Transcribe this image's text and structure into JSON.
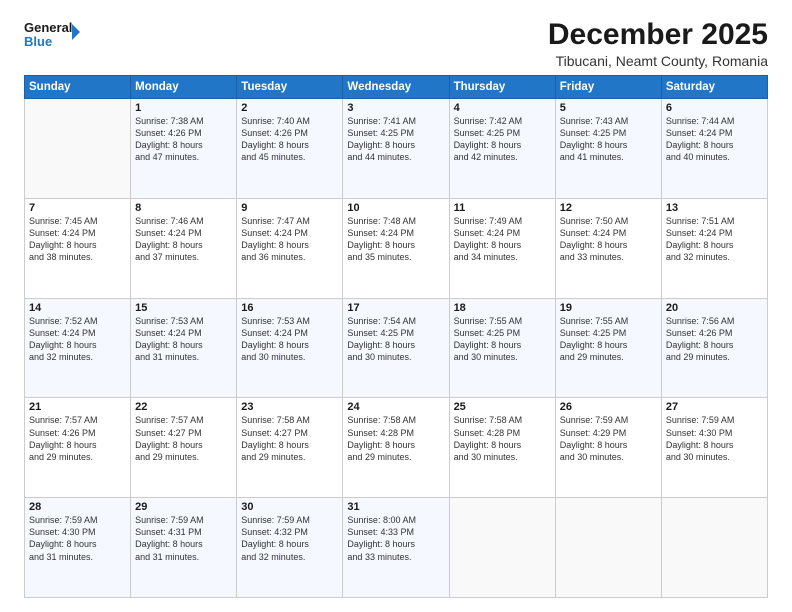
{
  "header": {
    "logo_line1": "General",
    "logo_line2": "Blue",
    "month": "December 2025",
    "location": "Tibucani, Neamt County, Romania"
  },
  "weekdays": [
    "Sunday",
    "Monday",
    "Tuesday",
    "Wednesday",
    "Thursday",
    "Friday",
    "Saturday"
  ],
  "weeks": [
    [
      {
        "day": "",
        "info": ""
      },
      {
        "day": "1",
        "info": "Sunrise: 7:38 AM\nSunset: 4:26 PM\nDaylight: 8 hours\nand 47 minutes."
      },
      {
        "day": "2",
        "info": "Sunrise: 7:40 AM\nSunset: 4:26 PM\nDaylight: 8 hours\nand 45 minutes."
      },
      {
        "day": "3",
        "info": "Sunrise: 7:41 AM\nSunset: 4:25 PM\nDaylight: 8 hours\nand 44 minutes."
      },
      {
        "day": "4",
        "info": "Sunrise: 7:42 AM\nSunset: 4:25 PM\nDaylight: 8 hours\nand 42 minutes."
      },
      {
        "day": "5",
        "info": "Sunrise: 7:43 AM\nSunset: 4:25 PM\nDaylight: 8 hours\nand 41 minutes."
      },
      {
        "day": "6",
        "info": "Sunrise: 7:44 AM\nSunset: 4:24 PM\nDaylight: 8 hours\nand 40 minutes."
      }
    ],
    [
      {
        "day": "7",
        "info": "Sunrise: 7:45 AM\nSunset: 4:24 PM\nDaylight: 8 hours\nand 38 minutes."
      },
      {
        "day": "8",
        "info": "Sunrise: 7:46 AM\nSunset: 4:24 PM\nDaylight: 8 hours\nand 37 minutes."
      },
      {
        "day": "9",
        "info": "Sunrise: 7:47 AM\nSunset: 4:24 PM\nDaylight: 8 hours\nand 36 minutes."
      },
      {
        "day": "10",
        "info": "Sunrise: 7:48 AM\nSunset: 4:24 PM\nDaylight: 8 hours\nand 35 minutes."
      },
      {
        "day": "11",
        "info": "Sunrise: 7:49 AM\nSunset: 4:24 PM\nDaylight: 8 hours\nand 34 minutes."
      },
      {
        "day": "12",
        "info": "Sunrise: 7:50 AM\nSunset: 4:24 PM\nDaylight: 8 hours\nand 33 minutes."
      },
      {
        "day": "13",
        "info": "Sunrise: 7:51 AM\nSunset: 4:24 PM\nDaylight: 8 hours\nand 32 minutes."
      }
    ],
    [
      {
        "day": "14",
        "info": "Sunrise: 7:52 AM\nSunset: 4:24 PM\nDaylight: 8 hours\nand 32 minutes."
      },
      {
        "day": "15",
        "info": "Sunrise: 7:53 AM\nSunset: 4:24 PM\nDaylight: 8 hours\nand 31 minutes."
      },
      {
        "day": "16",
        "info": "Sunrise: 7:53 AM\nSunset: 4:24 PM\nDaylight: 8 hours\nand 30 minutes."
      },
      {
        "day": "17",
        "info": "Sunrise: 7:54 AM\nSunset: 4:25 PM\nDaylight: 8 hours\nand 30 minutes."
      },
      {
        "day": "18",
        "info": "Sunrise: 7:55 AM\nSunset: 4:25 PM\nDaylight: 8 hours\nand 30 minutes."
      },
      {
        "day": "19",
        "info": "Sunrise: 7:55 AM\nSunset: 4:25 PM\nDaylight: 8 hours\nand 29 minutes."
      },
      {
        "day": "20",
        "info": "Sunrise: 7:56 AM\nSunset: 4:26 PM\nDaylight: 8 hours\nand 29 minutes."
      }
    ],
    [
      {
        "day": "21",
        "info": "Sunrise: 7:57 AM\nSunset: 4:26 PM\nDaylight: 8 hours\nand 29 minutes."
      },
      {
        "day": "22",
        "info": "Sunrise: 7:57 AM\nSunset: 4:27 PM\nDaylight: 8 hours\nand 29 minutes."
      },
      {
        "day": "23",
        "info": "Sunrise: 7:58 AM\nSunset: 4:27 PM\nDaylight: 8 hours\nand 29 minutes."
      },
      {
        "day": "24",
        "info": "Sunrise: 7:58 AM\nSunset: 4:28 PM\nDaylight: 8 hours\nand 29 minutes."
      },
      {
        "day": "25",
        "info": "Sunrise: 7:58 AM\nSunset: 4:28 PM\nDaylight: 8 hours\nand 30 minutes."
      },
      {
        "day": "26",
        "info": "Sunrise: 7:59 AM\nSunset: 4:29 PM\nDaylight: 8 hours\nand 30 minutes."
      },
      {
        "day": "27",
        "info": "Sunrise: 7:59 AM\nSunset: 4:30 PM\nDaylight: 8 hours\nand 30 minutes."
      }
    ],
    [
      {
        "day": "28",
        "info": "Sunrise: 7:59 AM\nSunset: 4:30 PM\nDaylight: 8 hours\nand 31 minutes."
      },
      {
        "day": "29",
        "info": "Sunrise: 7:59 AM\nSunset: 4:31 PM\nDaylight: 8 hours\nand 31 minutes."
      },
      {
        "day": "30",
        "info": "Sunrise: 7:59 AM\nSunset: 4:32 PM\nDaylight: 8 hours\nand 32 minutes."
      },
      {
        "day": "31",
        "info": "Sunrise: 8:00 AM\nSunset: 4:33 PM\nDaylight: 8 hours\nand 33 minutes."
      },
      {
        "day": "",
        "info": ""
      },
      {
        "day": "",
        "info": ""
      },
      {
        "day": "",
        "info": ""
      }
    ]
  ]
}
